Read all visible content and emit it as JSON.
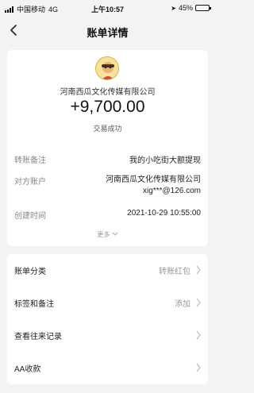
{
  "status_bar": {
    "carrier": "中国移动",
    "network": "4G",
    "time": "上午10:57",
    "battery": "45%",
    "battery_level": 0.45
  },
  "nav": {
    "title": "账单详情"
  },
  "transaction": {
    "merchant": "河南西瓜文化传媒有限公司",
    "amount": "+9,700.00",
    "status": "交易成功"
  },
  "details": [
    {
      "label": "转账备注",
      "value": "我的小吃街大额提现"
    },
    {
      "label": "对方账户",
      "value": "河南西瓜文化传媒有限公司 xig***@126.com"
    },
    {
      "label": "创建时间",
      "value": "2021-10-29 10:55:00"
    }
  ],
  "more_label": "更多",
  "actions": [
    {
      "label": "账单分类",
      "value": "转账红包"
    },
    {
      "label": "标签和备注",
      "value": "添加"
    },
    {
      "label": "查看往来记录",
      "value": ""
    },
    {
      "label": "AA收款",
      "value": ""
    }
  ],
  "colors": {
    "background": "#f3f3f3",
    "card": "#ffffff",
    "muted": "#888888"
  }
}
